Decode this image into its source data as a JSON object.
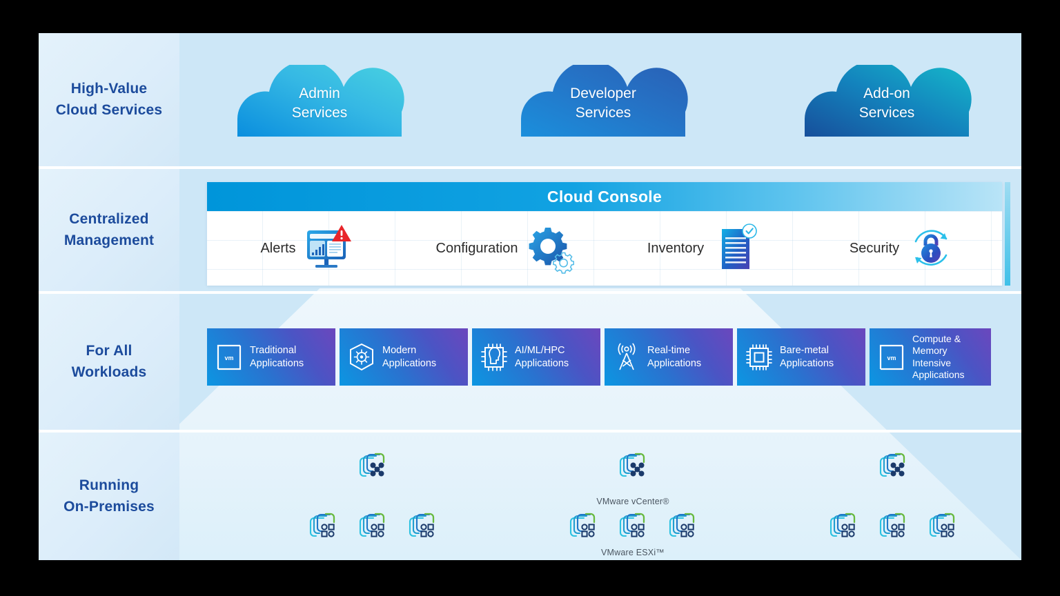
{
  "rows": [
    {
      "label": "High-Value\nCloud Services",
      "name": "high-value-cloud-services"
    },
    {
      "label": "Centralized\nManagement",
      "name": "centralized-management"
    },
    {
      "label": "For All\nWorkloads",
      "name": "for-all-workloads"
    },
    {
      "label": "Running\nOn-Premises",
      "name": "running-on-premises"
    }
  ],
  "clouds": [
    {
      "label": "Admin\nServices",
      "icon": "cloud-icon",
      "grad_from": "#1b8fe0",
      "grad_to": "#45cfe0"
    },
    {
      "label": "Developer\nServices",
      "icon": "cloud-icon",
      "grad_from": "#1c86d8",
      "grad_to": "#2b63b8"
    },
    {
      "label": "Add-on\nServices",
      "icon": "cloud-icon",
      "grad_from": "#17519c",
      "grad_to": "#17b6c9"
    }
  ],
  "console": {
    "title": "Cloud Console",
    "bar_color_start": "#0095da",
    "bar_color_end": "#b9e4f7",
    "items": [
      {
        "label": "Alerts",
        "icon": "monitor-alert-icon"
      },
      {
        "label": "Configuration",
        "icon": "gears-icon"
      },
      {
        "label": "Inventory",
        "icon": "document-check-icon"
      },
      {
        "label": "Security",
        "icon": "lock-refresh-icon"
      }
    ]
  },
  "workloads": {
    "tile_grad_from": "#0c96e2",
    "tile_grad_to": "#6b47bd",
    "tiles": [
      {
        "label": "Traditional\nApplications",
        "icon": "vm-box-icon"
      },
      {
        "label": "Modern\nApplications",
        "icon": "kubernetes-icon"
      },
      {
        "label": "AI/ML/HPC\nApplications",
        "icon": "ai-chip-icon"
      },
      {
        "label": "Real-time\nApplications",
        "icon": "antenna-tower-icon"
      },
      {
        "label": "Bare-metal\nApplications",
        "icon": "cpu-chip-icon"
      },
      {
        "label": "Compute &\nMemory\nIntensive\nApplications",
        "icon": "vm-box-icon"
      }
    ]
  },
  "onprem": {
    "groups": [
      {
        "vcenter_caption": "",
        "esxi_caption": "",
        "esxi_count": 3,
        "icon_vcenter": "vcenter-icon",
        "icon_esxi": "esxi-icon"
      },
      {
        "vcenter_caption": "VMware vCenter®",
        "esxi_caption": "VMware ESXi™",
        "esxi_count": 3,
        "icon_vcenter": "vcenter-icon",
        "icon_esxi": "esxi-icon"
      },
      {
        "vcenter_caption": "",
        "esxi_caption": "",
        "esxi_count": 3,
        "icon_vcenter": "vcenter-icon",
        "icon_esxi": "esxi-icon"
      }
    ]
  },
  "colors": {
    "panel_bg": "#cde7f7",
    "label_text": "#1c4b9c",
    "funnel": "#eef7fc",
    "vmware_cyan": "#21b3d6",
    "vmware_green": "#67b93e",
    "vmware_navy": "#1b3a6b"
  }
}
